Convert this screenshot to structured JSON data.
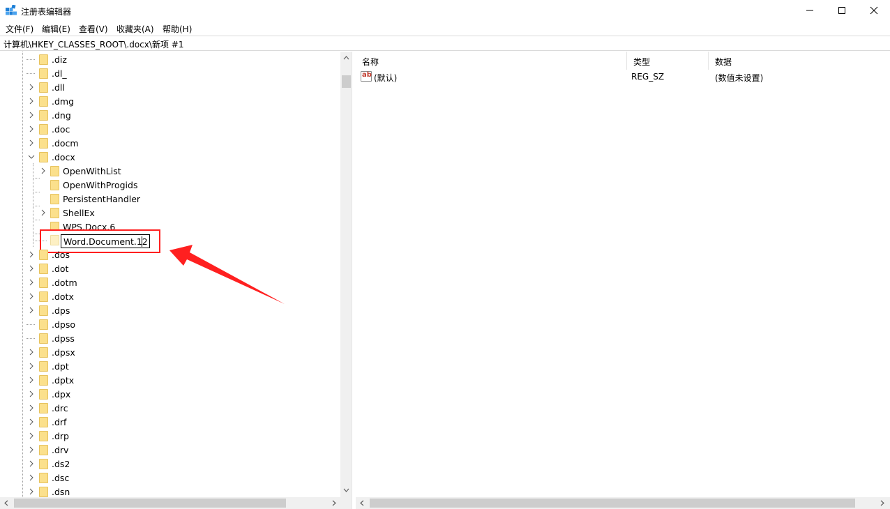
{
  "window": {
    "title": "注册表编辑器",
    "controls": {
      "minimize": "minimize-icon",
      "maximize": "maximize-icon",
      "close": "close-icon"
    }
  },
  "menu": {
    "items": [
      "文件(F)",
      "编辑(E)",
      "查看(V)",
      "收藏夹(A)",
      "帮助(H)"
    ]
  },
  "address": {
    "path": "计算机\\HKEY_CLASSES_ROOT\\.docx\\新项 #1"
  },
  "tree": {
    "top_items_before": [
      ".diz",
      ".dl_",
      ".dll",
      ".dmg",
      ".dng",
      ".doc",
      ".docm"
    ],
    "expanded_item": ".docx",
    "children": [
      "OpenWithList",
      "OpenWithProgids",
      "PersistentHandler",
      "ShellEx",
      "WPS.Docx.6"
    ],
    "editing_value": "Word.Document.12",
    "top_items_after": [
      ".dos",
      ".dot",
      ".dotm",
      ".dotx",
      ".dps",
      ".dpso",
      ".dpss",
      ".dpsx",
      ".dpt",
      ".dptx",
      ".dpx",
      ".drc",
      ".drf",
      ".drp",
      ".drv",
      ".ds2",
      ".dsc",
      ".dsn"
    ]
  },
  "list": {
    "columns": [
      "名称",
      "类型",
      "数据"
    ],
    "rows": [
      {
        "icon": "string-value-icon",
        "name": "(默认)",
        "type": "REG_SZ",
        "data": "(数值未设置)"
      }
    ]
  },
  "annotation": {
    "color": "#ff2020"
  }
}
